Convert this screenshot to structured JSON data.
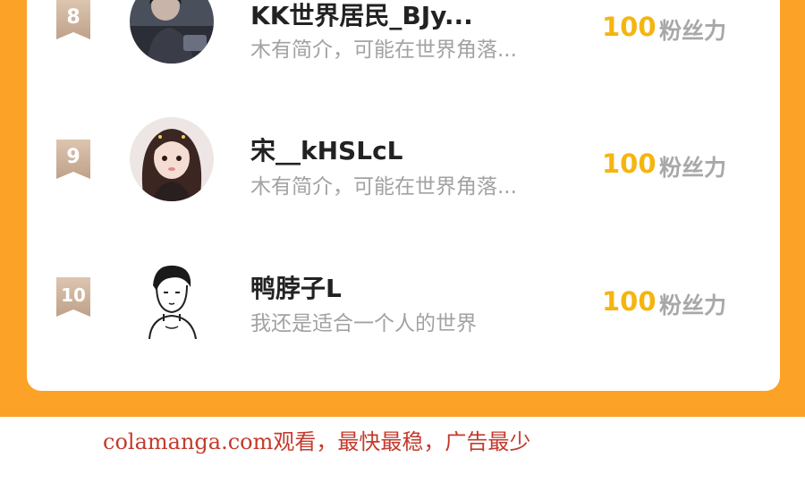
{
  "ranking": {
    "rows": [
      {
        "rank": "8",
        "name": "KK世界居民_BJy...",
        "bio": "木有简介，可能在世界角落...",
        "score": "100",
        "score_unit": "粉丝力"
      },
      {
        "rank": "9",
        "name": "宋__kHSLcL",
        "bio": "木有简介，可能在世界角落...",
        "score": "100",
        "score_unit": "粉丝力"
      },
      {
        "rank": "10",
        "name": "鸭脖子L",
        "bio": "我还是适合一个人的世界",
        "score": "100",
        "score_unit": "粉丝力"
      }
    ]
  },
  "watermark": {
    "text": "colamanga.com观看，最快最稳，广告最少"
  },
  "colors": {
    "accent_orange": "#fba227",
    "score_yellow": "#f5b50f",
    "rank_badge": "#c8a98c"
  }
}
